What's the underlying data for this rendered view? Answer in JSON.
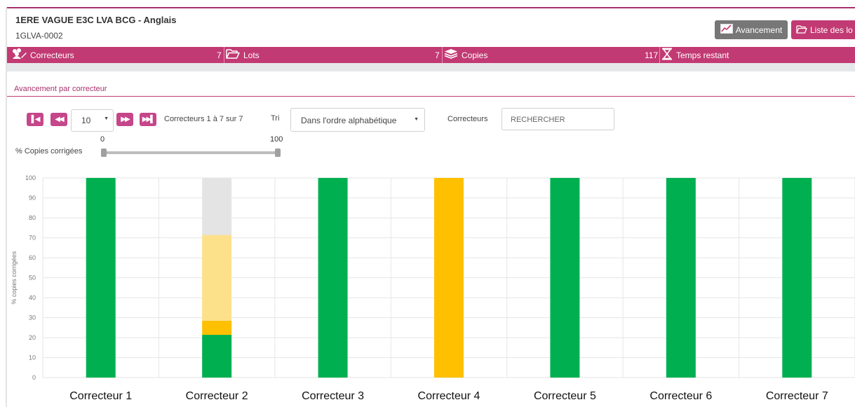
{
  "header": {
    "exam_title": "1ERE VAGUE E3C LVA BCG - Anglais",
    "exam_code": "1GLVA-0002",
    "avancement_button": "Avancement",
    "lots_button": "Liste des lo"
  },
  "stats": {
    "correcteurs_label": "Correcteurs",
    "correcteurs_count": "7",
    "lots_label": "Lots",
    "lots_count": "7",
    "copies_label": "Copies",
    "copies_count": "117",
    "temps_label": "Temps restant"
  },
  "section": {
    "title": "Avancement par correcteur"
  },
  "pagination": {
    "page_size": "10",
    "range": "Correcteurs 1 à 7 sur 7",
    "sort_label": "Tri",
    "sort_value": "Dans l'ordre alphabétique",
    "search_label": "Correcteurs",
    "search_placeholder": "RECHERCHER"
  },
  "slider": {
    "label": "% Copies corrigées",
    "min": "0",
    "max": "100",
    "value_low": 0,
    "value_high": 100
  },
  "colors": {
    "accent": "#c23a73",
    "corrected": "#00b050",
    "in_progress": "#ffc000",
    "pending": "#fde08a",
    "remaining": "#e4e4e4"
  },
  "chart_data": {
    "type": "bar",
    "stacked": true,
    "ylabel": "% copies corrigées",
    "ylim": [
      0,
      100
    ],
    "yticks": [
      "0",
      "10",
      "20",
      "30",
      "40",
      "50",
      "60",
      "70",
      "80",
      "90",
      "100"
    ],
    "grid": true,
    "categories": [
      "Correcteur 1",
      "Correcteur 2",
      "Correcteur 3",
      "Correcteur 4",
      "Correcteur 5",
      "Correcteur 6",
      "Correcteur 7"
    ],
    "series": [
      {
        "color": "#00b050",
        "values": [
          100,
          21.4,
          100,
          0,
          100,
          100,
          100
        ]
      },
      {
        "color": "#ffc000",
        "values": [
          0,
          7.1,
          0,
          100,
          0,
          0,
          0
        ]
      },
      {
        "color": "#fde08a",
        "values": [
          0,
          42.9,
          0,
          0,
          0,
          0,
          0
        ]
      },
      {
        "color": "#e4e4e4",
        "values": [
          0,
          28.6,
          0,
          0,
          0,
          0,
          0
        ]
      }
    ]
  }
}
